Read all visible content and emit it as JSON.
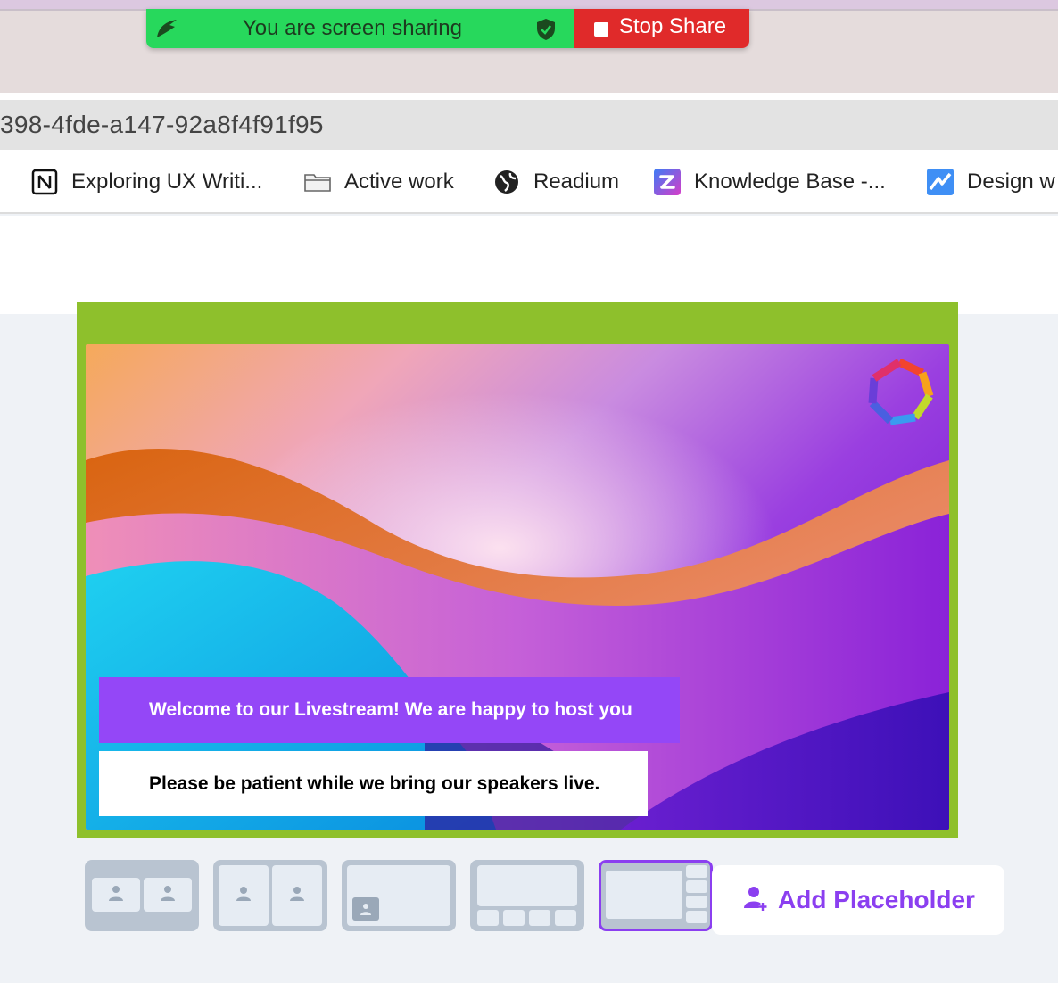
{
  "screen_share": {
    "status_text": "You are screen sharing",
    "stop_label": "Stop Share"
  },
  "browser": {
    "url_fragment": "398-4fde-a147-92a8f4f91f95",
    "bookmarks": [
      {
        "label": "Exploring UX Writi...",
        "icon": "notion-icon"
      },
      {
        "label": "Active work",
        "icon": "folder-icon"
      },
      {
        "label": "Readium",
        "icon": "globe-icon"
      },
      {
        "label": "Knowledge Base -...",
        "icon": "z-logo-icon"
      },
      {
        "label": "Design w",
        "icon": "design-app-icon"
      }
    ]
  },
  "stage": {
    "frame_color": "#8ec02c",
    "banners": {
      "primary": "Welcome to our Livestream! We are happy to host you",
      "secondary": "Please be patient while we bring our speakers live."
    }
  },
  "layouts": [
    {
      "name": "two-side-by-side",
      "selected": false
    },
    {
      "name": "two-split",
      "selected": false
    },
    {
      "name": "screen-with-pip",
      "selected": false
    },
    {
      "name": "main-with-bottom-row",
      "selected": false
    },
    {
      "name": "main-with-right-column",
      "selected": true
    }
  ],
  "actions": {
    "add_placeholder": "Add Placeholder"
  },
  "colors": {
    "accent_purple": "#8b3ff0",
    "share_green": "#27d85c",
    "stop_red": "#e02a2a"
  }
}
